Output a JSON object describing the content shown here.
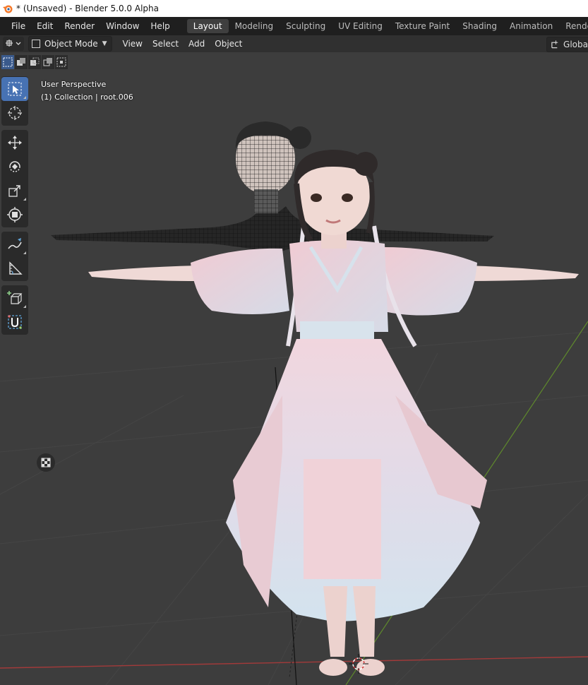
{
  "window": {
    "title": "* (Unsaved) - Blender 5.0.0 Alpha"
  },
  "menu": {
    "items": [
      "File",
      "Edit",
      "Render",
      "Window",
      "Help"
    ]
  },
  "workspaces": {
    "tabs": [
      "Layout",
      "Modeling",
      "Sculpting",
      "UV Editing",
      "Texture Paint",
      "Shading",
      "Animation",
      "Rendering"
    ],
    "active": "Layout"
  },
  "viewport_header": {
    "mode": "Object Mode",
    "menus": [
      "View",
      "Select",
      "Add",
      "Object"
    ],
    "transform_orientation": "Globa"
  },
  "viewport": {
    "perspective": "User Perspective",
    "collection_info": "(1) Collection | root.006"
  },
  "toolbar": {
    "tools": [
      {
        "name": "select-box",
        "icon": "select-box-icon",
        "active": true
      },
      {
        "name": "cursor",
        "icon": "cursor-icon"
      },
      {
        "name": "move",
        "icon": "move-icon"
      },
      {
        "name": "rotate",
        "icon": "rotate-icon"
      },
      {
        "name": "scale",
        "icon": "scale-icon"
      },
      {
        "name": "transform",
        "icon": "transform-icon"
      },
      {
        "name": "annotate",
        "icon": "annotate-icon"
      },
      {
        "name": "measure",
        "icon": "measure-icon"
      },
      {
        "name": "add-cube",
        "icon": "add-cube-icon"
      },
      {
        "name": "uv-unwrap",
        "icon": "uv-icon"
      }
    ]
  },
  "colors": {
    "accent": "#4772b3",
    "viewport_bg": "#3d3d3d",
    "x_axis": "#a33a3a",
    "y_axis": "#5f8a2c"
  }
}
